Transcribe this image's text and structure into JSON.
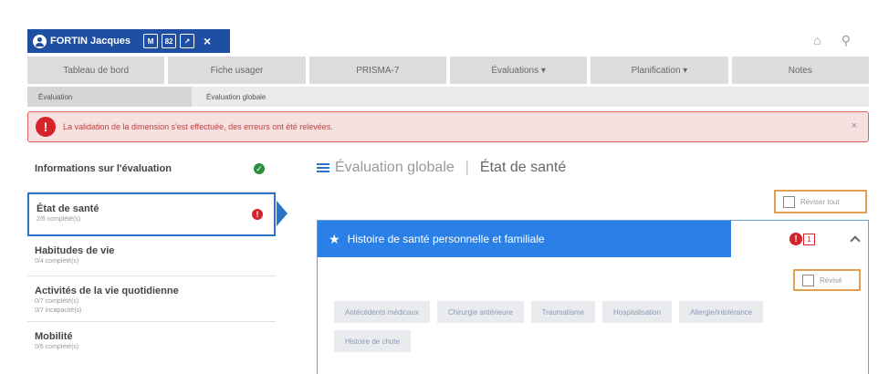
{
  "patient": {
    "name": "FORTIN Jacques",
    "icon1": "M",
    "icon2": "82",
    "close": "×"
  },
  "top_icons": {
    "home": "⌂",
    "search": "⚲"
  },
  "main_nav": [
    {
      "label": "Tableau de bord"
    },
    {
      "label": "Fiche usager"
    },
    {
      "label": "PRISMA-7"
    },
    {
      "label": "Évaluations ▾"
    },
    {
      "label": "Planification ▾"
    },
    {
      "label": "Notes"
    }
  ],
  "sub_nav": [
    {
      "label": "Évaluation"
    },
    {
      "label": "Évaluation globale"
    }
  ],
  "alert": {
    "message": "La validation de la dimension s'est effectuée, des erreurs ont été relevées.",
    "close": "×"
  },
  "sidebar": {
    "items": [
      {
        "title": "Informations sur l'évaluation",
        "subs": [],
        "status": "✓"
      },
      {
        "title": "État de santé",
        "subs": [
          "2/6 complété(s)"
        ],
        "status": "!"
      },
      {
        "title": "Habitudes de vie",
        "subs": [
          "0/4 complété(s)"
        ]
      },
      {
        "title": "Activités de la vie quotidienne",
        "subs": [
          "0/7 complété(s)",
          "0/7 incapacité(s)"
        ]
      },
      {
        "title": "Mobilité",
        "subs": [
          "0/6 complété(s)"
        ]
      }
    ]
  },
  "content": {
    "breadcrumb_main": "Évaluation globale",
    "breadcrumb_sep": "|",
    "breadcrumb_current": "État de santé",
    "revise_all_label": "Réviser tout",
    "panel": {
      "title": "Histoire de santé personnelle et familiale",
      "error_count": "1",
      "revise_label": "Révisé",
      "chips": [
        "Antécédents médicaux",
        "Chirurgie antérieure",
        "Traumatisme",
        "Hospitalisation",
        "Allergie/intolérance",
        "Histoire de chute"
      ]
    }
  },
  "colors": {
    "brand_blue": "#1e4fa3",
    "accent_blue": "#2b80e8",
    "error_red": "#d5222b",
    "success_green": "#2a8f3b",
    "review_orange": "#e0a050"
  }
}
